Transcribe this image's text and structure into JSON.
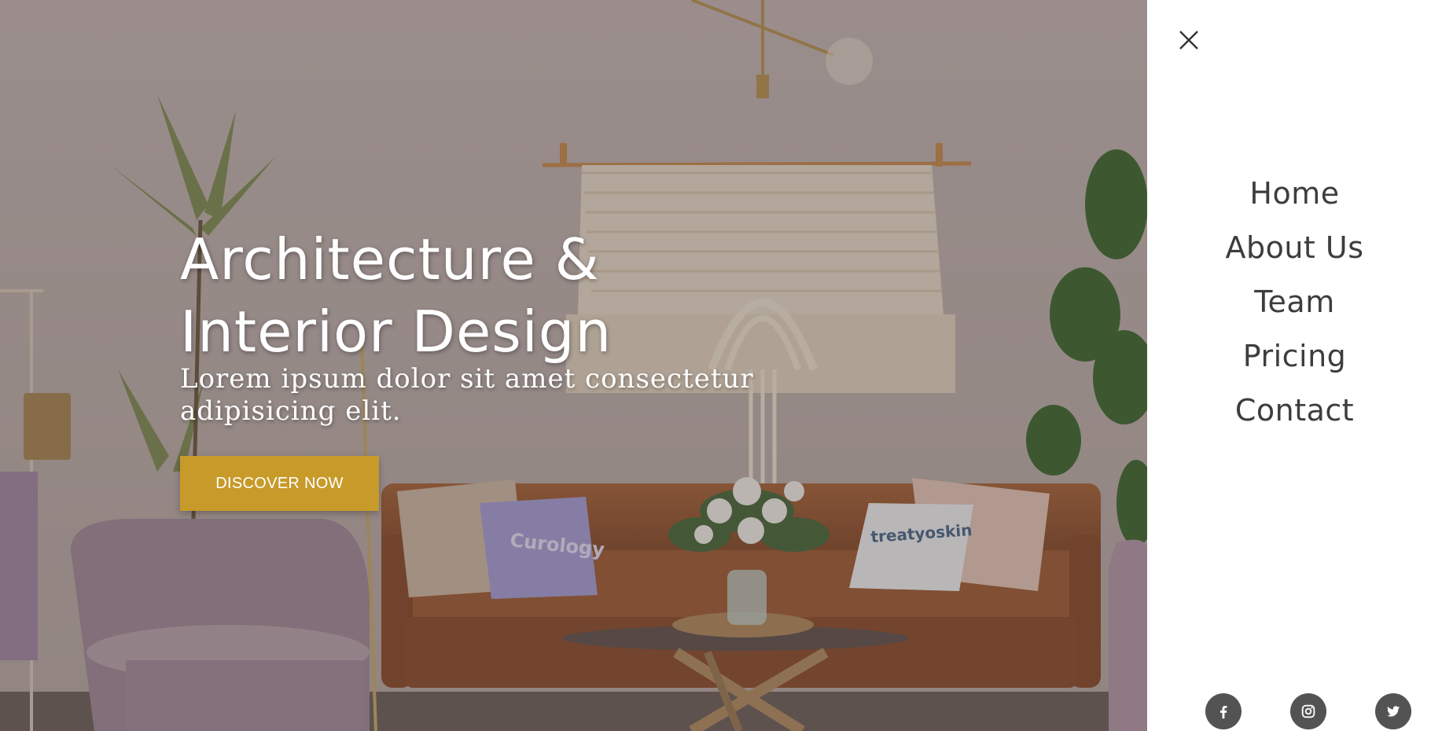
{
  "hero": {
    "title_line1": "Architecture &",
    "title_line2": "Interior Design",
    "subtitle": "Lorem ipsum dolor sit amet consectetur adipisicing elit.",
    "cta_label": "DISCOVER NOW",
    "pillow_left_text": "Curology",
    "pillow_right_text": "treatyoskin",
    "accent_color": "#c79a2a"
  },
  "menu": {
    "items": [
      {
        "label": "Home"
      },
      {
        "label": "About Us"
      },
      {
        "label": "Team"
      },
      {
        "label": "Pricing"
      },
      {
        "label": "Contact"
      }
    ],
    "close_icon": "close-icon",
    "social": [
      {
        "icon": "facebook-icon"
      },
      {
        "icon": "instagram-icon"
      },
      {
        "icon": "twitter-icon"
      }
    ]
  }
}
